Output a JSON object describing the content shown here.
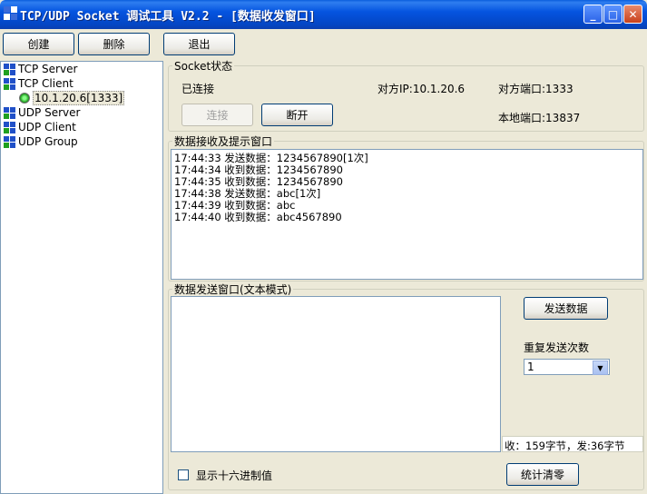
{
  "window": {
    "title": "TCP/UDP Socket 调试工具 V2.2 - [数据收发窗口]",
    "minimize_glyph": "_",
    "maximize_glyph": "□",
    "close_glyph": "✕"
  },
  "toolbar": {
    "create_label": "创建",
    "delete_label": "删除",
    "exit_label": "退出"
  },
  "tree": {
    "items": [
      {
        "label": "TCP Server"
      },
      {
        "label": "TCP Client"
      },
      {
        "label": "10.1.20.6[1333]"
      },
      {
        "label": "UDP Server"
      },
      {
        "label": "UDP Client"
      },
      {
        "label": "UDP Group"
      }
    ]
  },
  "socket_status": {
    "group_title": "Socket状态",
    "status": "已连接",
    "remote_ip": "对方IP:10.1.20.6",
    "remote_port": "对方端口:1333",
    "local_port": "本地端口:13837",
    "connect_label": "连接",
    "disconnect_label": "断开"
  },
  "receive": {
    "group_title": "数据接收及提示窗口",
    "lines": [
      "17:44:33 发送数据：1234567890[1次]",
      "17:44:34 收到数据：1234567890",
      "17:44:35 收到数据：1234567890",
      "17:44:38 发送数据：abc[1次]",
      "17:44:39 收到数据：abc",
      "17:44:40 收到数据：abc4567890"
    ]
  },
  "send": {
    "group_title": "数据发送窗口(文本模式)",
    "send_button": "发送数据",
    "repeat_label": "重复发送次数",
    "repeat_value": "1",
    "stats": "收：159字节，发:36字节",
    "hex_label": "显示十六进制值",
    "clear_stats_button": "统计清零"
  }
}
